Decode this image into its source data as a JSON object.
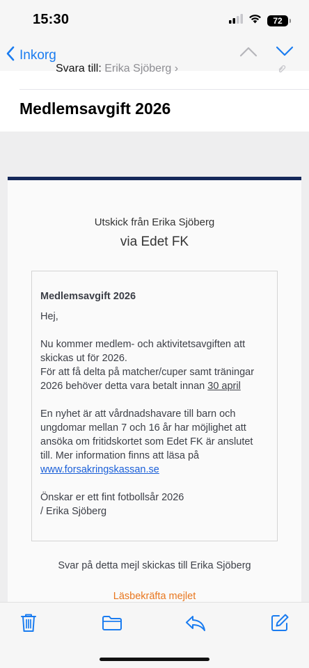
{
  "status_bar": {
    "time": "15:30",
    "battery": "72"
  },
  "nav": {
    "back_label": "Inkorg"
  },
  "header": {
    "reply_to_label": "Svara till:",
    "reply_to_name": "Erika Sjöberg",
    "subject": "Medlemsavgift 2026"
  },
  "email": {
    "sender_line1": "Utskick från Erika Sjöberg",
    "sender_line2": "via Edet FK",
    "title": "Medlemsavgift 2026",
    "greeting": "Hej,",
    "para1_a": "Nu kommer medlem- och aktivitetsavgiften att skickas ut för 2026.",
    "para1_b": "För att få delta på matcher/cuper samt träningar 2026 behöver detta vara betalt innan",
    "deadline": "30 april",
    "para2": "En nyhet är att vårdnadshavare till barn och ungdomar mellan 7 och 16 år har möjlighet att ansöka om fritidskortet som Edet FK är anslutet till. Mer information finns att läsa på",
    "link": "www.forsakringskassan.se",
    "closing": "Önskar er ett fint fotbollsår 2026",
    "signature": "/ Erika Sjöberg",
    "reply_note": "Svar på detta mejl skickas till Erika Sjöberg",
    "read_confirm": "Läsbekräfta mejlet"
  },
  "colors": {
    "accent": "#1a7cf0",
    "card_border": "#15285a",
    "link": "#1a5fd8",
    "orange": "#e8761d"
  },
  "icons": {
    "toolbar": [
      "trash-icon",
      "folder-icon",
      "reply-icon",
      "compose-icon"
    ]
  }
}
